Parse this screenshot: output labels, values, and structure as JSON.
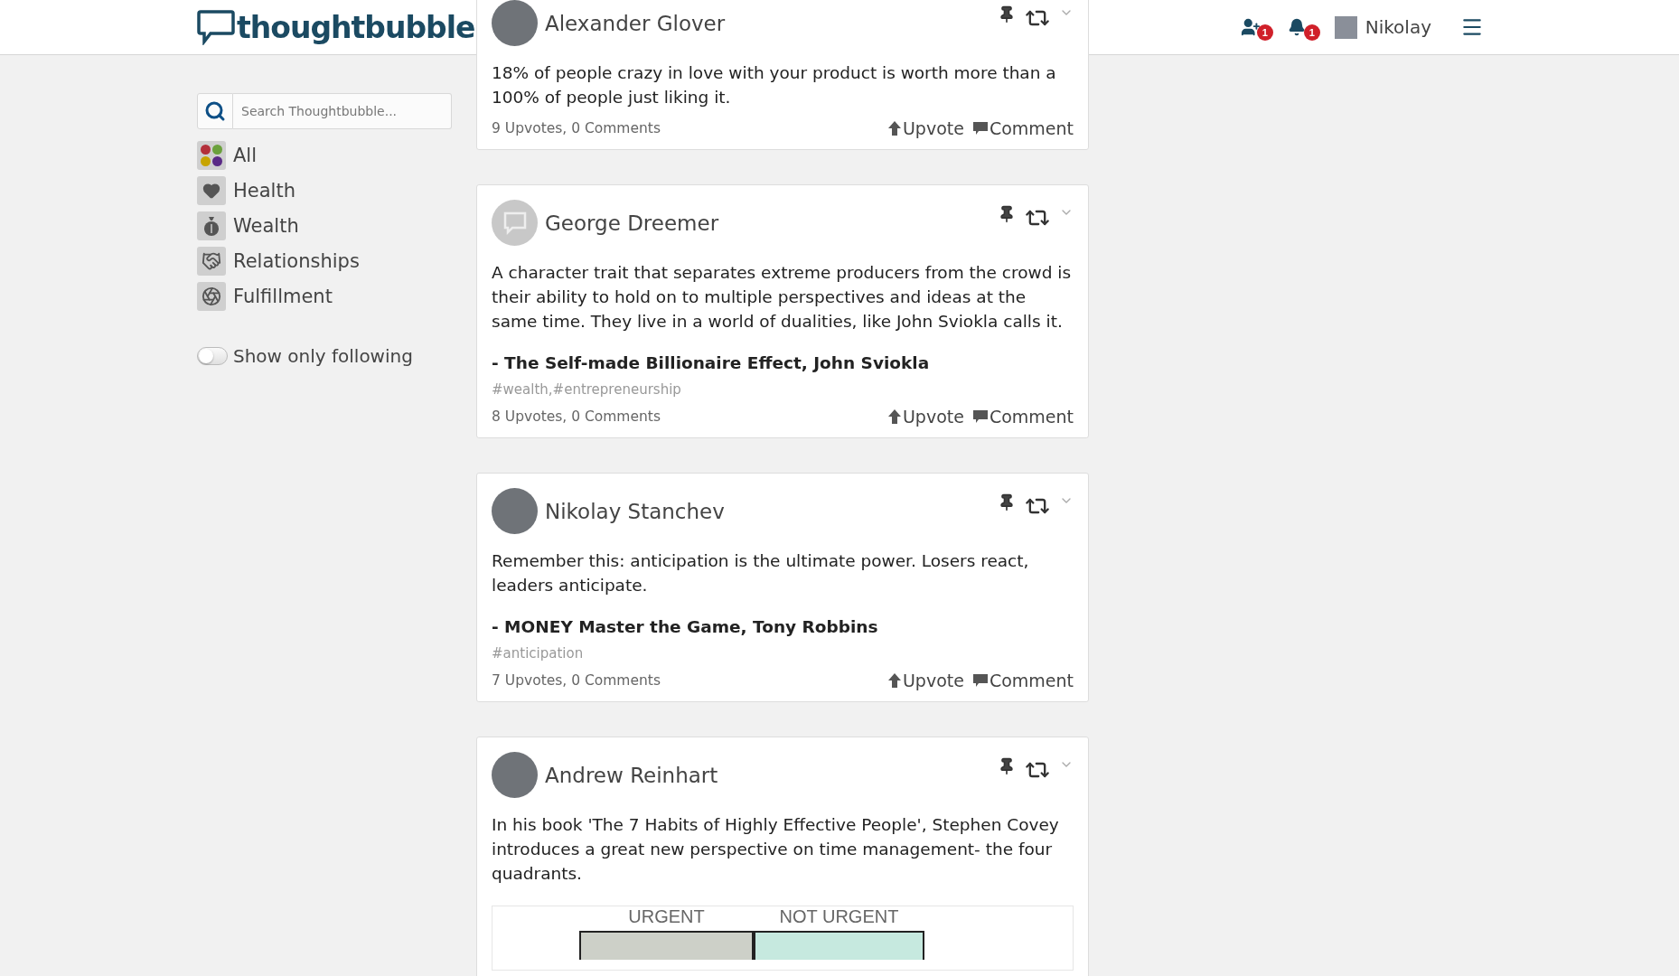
{
  "header": {
    "logo": "thoughtbubble",
    "invite_badge": "1",
    "notification_badge": "1",
    "user_name": "Nikolay"
  },
  "sidebar": {
    "search": {
      "placeholder": "Search Thoughtbubble..."
    },
    "categories": [
      {
        "label": "All",
        "kind": "all"
      },
      {
        "label": "Health",
        "kind": "health"
      },
      {
        "label": "Wealth",
        "kind": "wealth"
      },
      {
        "label": "Relationships",
        "kind": "relationships"
      },
      {
        "label": "Fulfillment",
        "kind": "fulfillment"
      }
    ],
    "following_toggle": {
      "label": "Show only following",
      "on": false
    }
  },
  "posts": [
    {
      "author": "Alexander Glover",
      "default_avatar": false,
      "text": "18% of people crazy in love with your product is worth more than a 100% of people just liking it.",
      "stats": "9 Upvotes, 0 Comments",
      "actions": [
        "Upvote",
        "Comment"
      ]
    },
    {
      "author": "George Dreemer",
      "default_avatar": true,
      "text": "A character trait that separates extreme producers from the crowd is their ability to hold on to multiple perspectives and ideas at the same time. They live in a world of dualities, like John Sviokla calls it.",
      "quote": "- The Self-made Billionaire Effect, John Sviokla",
      "tags": "#wealth,#entrepreneurship",
      "stats": "8 Upvotes, 0 Comments",
      "actions": [
        "Upvote",
        "Comment"
      ]
    },
    {
      "author": "Nikolay Stanchev",
      "default_avatar": false,
      "text": "Remember this: anticipation is the ultimate power. Losers react, leaders anticipate.",
      "quote": "- MONEY Master the Game, Tony Robbins",
      "tags": "#anticipation",
      "stats": "7 Upvotes, 0 Comments",
      "actions": [
        "Upvote",
        "Comment"
      ]
    },
    {
      "author": "Andrew Reinhart",
      "default_avatar": false,
      "text": "In his book 'The 7 Habits of Highly Effective People', Stephen Covey introduces a great new perspective on time management- the four quadrants.",
      "image": {
        "labels": [
          "URGENT",
          "NOT URGENT"
        ]
      }
    }
  ]
}
